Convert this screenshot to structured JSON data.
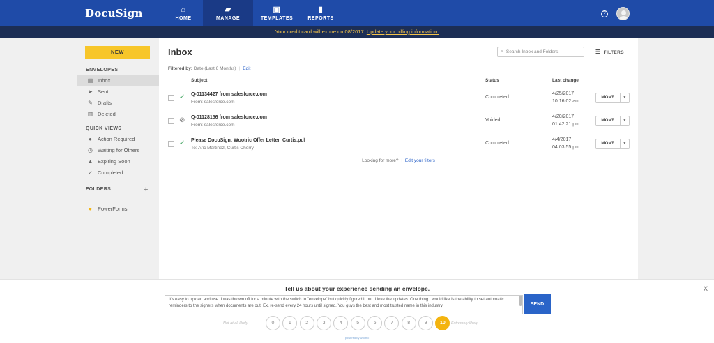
{
  "app": {
    "logo_text": "DocuSign"
  },
  "nav": {
    "items": [
      {
        "label": "HOME",
        "icon": "home-icon",
        "glyph": "⌂"
      },
      {
        "label": "MANAGE",
        "icon": "folder-icon",
        "glyph": "▰",
        "active": true
      },
      {
        "label": "TEMPLATES",
        "icon": "template-icon",
        "glyph": "▣"
      },
      {
        "label": "REPORTS",
        "icon": "bar-chart-icon",
        "glyph": "▮"
      }
    ],
    "help_glyph": "?"
  },
  "banner": {
    "text": "Your credit card will expire on 08/2017.",
    "link": "Update your billing information."
  },
  "sidebar": {
    "new_label": "NEW",
    "envelopes_heading": "ENVELOPES",
    "envelopes": [
      {
        "label": "Inbox",
        "icon": "inbox-icon",
        "glyph": "▤"
      },
      {
        "label": "Sent",
        "icon": "send-icon",
        "glyph": "➤"
      },
      {
        "label": "Drafts",
        "icon": "draft-icon",
        "glyph": "✎"
      },
      {
        "label": "Deleted",
        "icon": "trash-icon",
        "glyph": "▥"
      }
    ],
    "quick_views_heading": "QUICK VIEWS",
    "quick_views": [
      {
        "label": "Action Required",
        "icon": "alert-circle-icon",
        "glyph": "●"
      },
      {
        "label": "Waiting for Others",
        "icon": "clock-icon",
        "glyph": "◷"
      },
      {
        "label": "Expiring Soon",
        "icon": "warning-icon",
        "glyph": "▲"
      },
      {
        "label": "Completed",
        "icon": "check-icon",
        "glyph": "✓"
      }
    ],
    "folders_heading": "FOLDERS",
    "plus_glyph": "+",
    "powerforms": {
      "label": "PowerForms",
      "icon": "powerforms-icon",
      "glyph": "●"
    }
  },
  "main": {
    "title": "Inbox",
    "search_placeholder": "Search Inbox and Folders",
    "search_glyph": "⌕",
    "filters_label": "FILTERS",
    "filters_glyph": "☰",
    "filtered_by_label": "Filtered by:",
    "filtered_by_value": "Date (Last 6 Months)",
    "filter_sep": "|",
    "edit_label": "Edit",
    "columns": {
      "subject": "Subject",
      "status": "Status",
      "last_change": "Last change"
    },
    "rows": [
      {
        "subject": "Q-01134427 from salesforce.com",
        "from": "From: salesforce.com",
        "status": "Completed",
        "status_glyph": "✓",
        "status_color": "#3aa05a",
        "status_icon": "check-icon",
        "date": "4/25/2017",
        "time": "10:16:02 am"
      },
      {
        "subject": "Q-01128156 from salesforce.com",
        "from": "From: salesforce.com",
        "status": "Voided",
        "status_glyph": "⊘",
        "status_color": "#777777",
        "status_icon": "voided-icon",
        "date": "4/20/2017",
        "time": "01:42:21 pm"
      },
      {
        "subject": "Please DocuSign: Wootric Offer Letter_Curtis.pdf",
        "from": "To: Aric Martinez, Curtis Cherry",
        "status": "Completed",
        "status_glyph": "✓",
        "status_color": "#3aa05a",
        "status_icon": "check-icon",
        "date": "4/4/2017",
        "time": "04:03:55 pm"
      }
    ],
    "move_label": "MOVE",
    "move_caret": "▼",
    "more_text": "Looking for more?",
    "more_sep": "|",
    "more_link": "Edit your filters"
  },
  "survey": {
    "title": "Tell us about your experience sending an envelope.",
    "close_glyph": "X",
    "comment": "It's easy to upload and use. I was thrown off for a minute with the switch to \"envelope\" but quickly figured it out. I love the updates. One thing I would like is the ability to set automatic reminders to the signers when documents are out. Ex. re-send every 24 hours until signed.  You guys the best and most trusted name in this industry.",
    "send_label": "SEND",
    "low_label": "Not at all likely",
    "high_label": "Extremely likely",
    "scale": [
      "0",
      "1",
      "2",
      "3",
      "4",
      "5",
      "6",
      "7",
      "8",
      "9",
      "10"
    ],
    "selected": "10",
    "powered_by": "powered by wootric"
  }
}
